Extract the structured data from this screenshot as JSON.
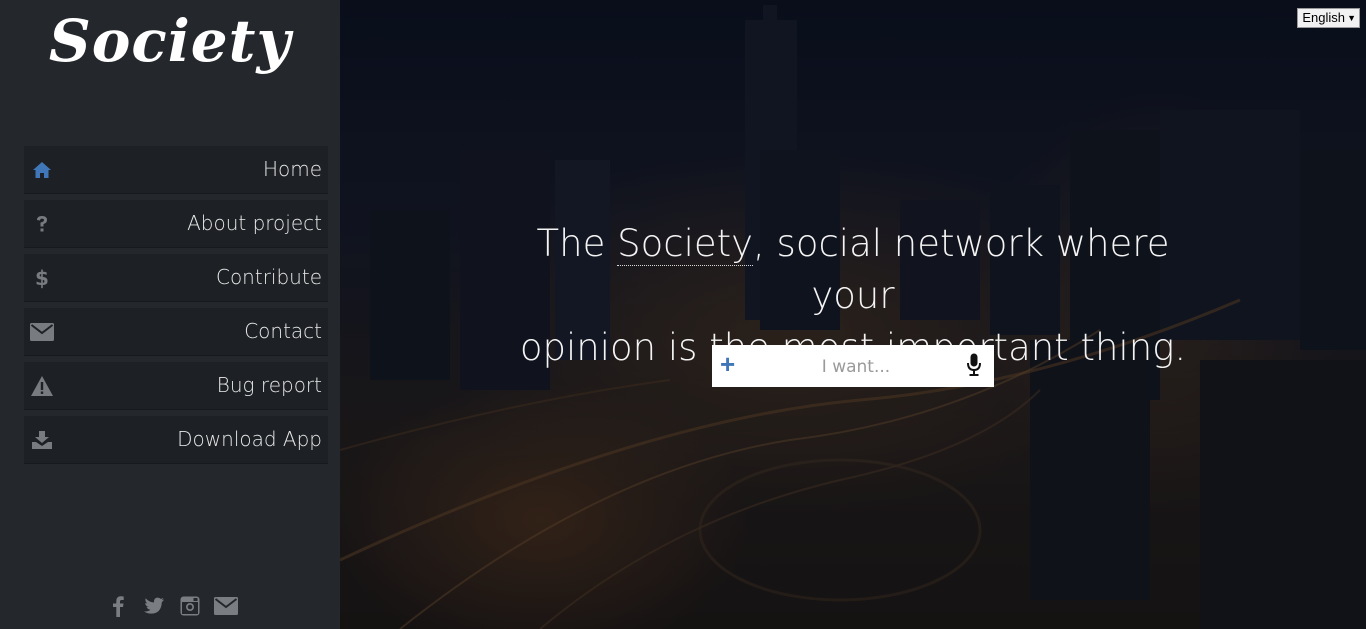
{
  "brand": {
    "logo_text": "Society"
  },
  "language": {
    "selected": "English",
    "arrow": "▼"
  },
  "nav": [
    {
      "label": "Home",
      "icon": "home-icon",
      "active": true
    },
    {
      "label": "About project",
      "icon": "question-icon"
    },
    {
      "label": "Contribute",
      "icon": "dollar-icon"
    },
    {
      "label": "Contact",
      "icon": "envelope-icon"
    },
    {
      "label": "Bug report",
      "icon": "warning-icon"
    },
    {
      "label": "Download App",
      "icon": "download-icon"
    }
  ],
  "social": [
    "facebook-icon",
    "twitter-icon",
    "instagram-icon",
    "mail-icon"
  ],
  "hero": {
    "prefix": "The ",
    "brand": "Society",
    "suffix_line1": ", social network where your",
    "line2": "opinion is the most important thing."
  },
  "search": {
    "placeholder": "I want...",
    "value": "",
    "plus_symbol": "+"
  },
  "colors": {
    "sidebar_bg": "#24272c",
    "nav_bg": "#1d2024",
    "accent": "#3f77b8",
    "text": "#e9e9e9"
  }
}
